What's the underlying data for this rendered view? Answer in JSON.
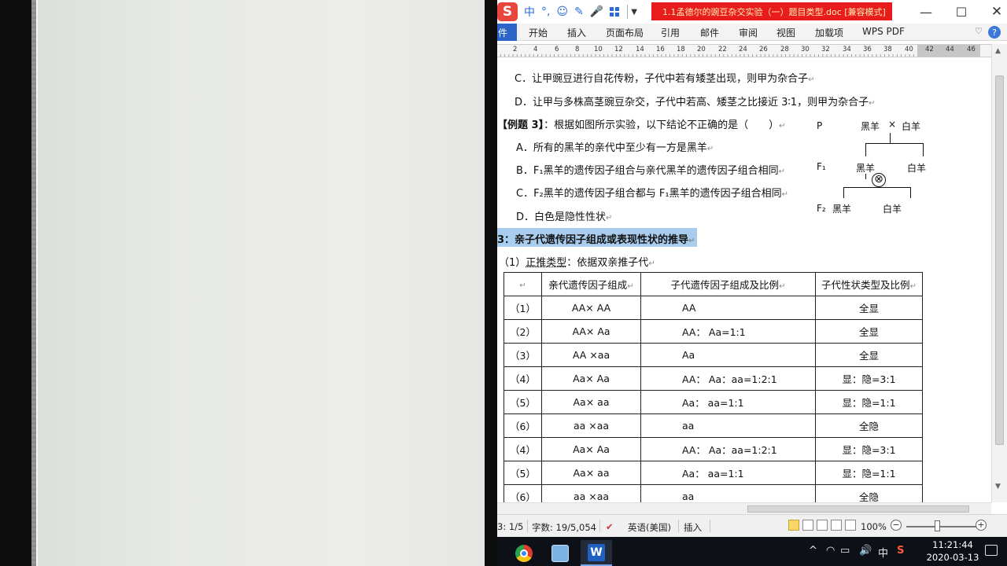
{
  "ime": {
    "mode_label": "中",
    "punct_label": "°,"
  },
  "window": {
    "title": "1.1孟德尔的豌豆杂交实验（一）题目类型.doc [兼容模式]",
    "minimize_icon": "—",
    "maximize_icon": "☐",
    "close_icon": "✕"
  },
  "ribbon": {
    "file_tab": "件",
    "tabs": [
      "开始",
      "插入",
      "页面布局",
      "引用",
      "邮件",
      "审阅",
      "视图",
      "加载项",
      "WPS PDF"
    ]
  },
  "ruler": {
    "numbers": [
      "2",
      "4",
      "6",
      "8",
      "10",
      "12",
      "14",
      "16",
      "18",
      "20",
      "22",
      "24",
      "26",
      "28",
      "30",
      "32",
      "34",
      "36",
      "38",
      "40",
      "42",
      "44",
      "46"
    ]
  },
  "document": {
    "pilcrow": "↵",
    "option_c_prev": "C．让甲豌豆进行自花传粉，子代中若有矮茎出现，则甲为杂合子",
    "option_d_prev": "D．让甲与多株高茎豌豆杂交，子代中若高、矮茎之比接近 3∶1，则甲为杂合子",
    "example_label": "【例题 3】",
    "example_text": "：根据如图所示实验，以下结论不正确的是（　　）",
    "options": [
      "A．所有的黑羊的亲代中至少有一方是黑羊",
      "B．F₁黑羊的遗传因子组合与亲代黑羊的遗传因子组合相同",
      "C．F₂黑羊的遗传因子组合都与 F₁黑羊的遗传因子组合相同",
      "D．白色是隐性性状"
    ],
    "diagram": {
      "p_label": "P",
      "black": "黑羊",
      "cross": "×",
      "white": "白羊",
      "f1_label": "F₁",
      "f2_label": "F₂",
      "self_symbol": "⊗"
    },
    "section_heading": "3：亲子代遗传因子组成或表现性状的推导",
    "sub_prefix": "（1）",
    "sub_term": "正推类型",
    "sub_suffix": "：依据双亲推子代",
    "table": {
      "headers": [
        "",
        "亲代遗传因子组成",
        "子代遗传因子组成及比例",
        "子代性状类型及比例"
      ],
      "rows": [
        [
          "（1）",
          "AA× AA",
          "AA",
          "全显"
        ],
        [
          "（2）",
          "AA× Aa",
          "AA：  Aa=1:1",
          "全显"
        ],
        [
          "（3）",
          "AA ×aa",
          "Aa",
          "全显"
        ],
        [
          "（4）",
          "Aa× Aa",
          "AA：  Aa：aa=1:2:1",
          "显：隐=3:1"
        ],
        [
          "（5）",
          "Aa× aa",
          "Aa：   aa=1:1",
          "显：隐=1:1"
        ],
        [
          "（6）",
          "aa ×aa",
          "aa",
          "全隐"
        ],
        [
          "（4）",
          "Aa× Aa",
          "AA：  Aa：aa=1:2:1",
          "显：隐=3:1"
        ],
        [
          "（5）",
          "Aa× aa",
          "Aa：   aa=1:1",
          "显：隐=1:1"
        ],
        [
          "（6）",
          "aa ×aa",
          "aa",
          "全隐"
        ]
      ]
    }
  },
  "status": {
    "page": "3: 1/5",
    "words": "字数: 19/5,054",
    "language": "英语(美国)",
    "insert_mode": "插入",
    "zoom": "100%",
    "zoom_minus": "−",
    "zoom_plus": "+"
  },
  "taskbar": {
    "word_label": "W",
    "tray_chevron": "^",
    "tray_volume": "🔊",
    "tray_ime": "中",
    "tray_sogou": "S",
    "time": "11:21:44",
    "date": "2020-03-13"
  }
}
